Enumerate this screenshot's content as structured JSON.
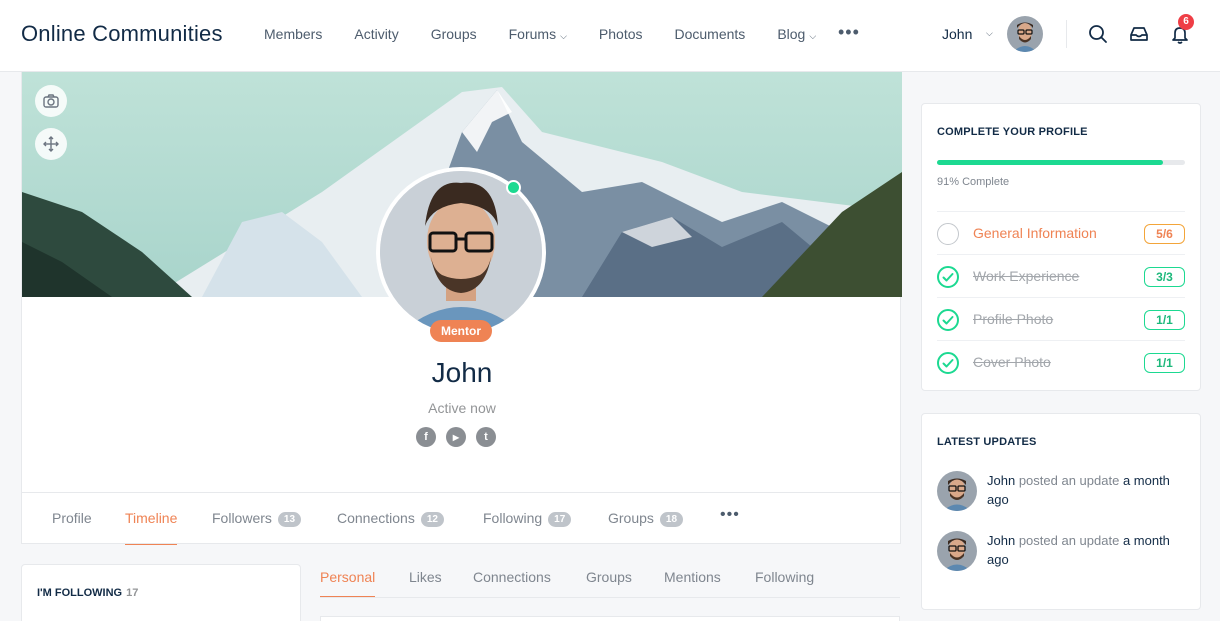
{
  "header": {
    "site_title": "Online Communities",
    "nav": [
      {
        "label": "Members",
        "active": true,
        "caret": false
      },
      {
        "label": "Activity",
        "active": false,
        "caret": false
      },
      {
        "label": "Groups",
        "active": false,
        "caret": false
      },
      {
        "label": "Forums",
        "active": false,
        "caret": true
      },
      {
        "label": "Photos",
        "active": false,
        "caret": false
      },
      {
        "label": "Documents",
        "active": false,
        "caret": false
      },
      {
        "label": "Blog",
        "active": false,
        "caret": true
      }
    ],
    "more_icon": "ellipsis-icon",
    "user_name": "John",
    "notification_count": "6",
    "icons": [
      "search-icon",
      "inbox-icon",
      "bell-icon"
    ],
    "accent_color": "#ef8354"
  },
  "profile": {
    "name": "John",
    "status": "Active now",
    "role_badge": "Mentor",
    "socials": [
      {
        "name": "facebook-icon",
        "glyph": "f"
      },
      {
        "name": "youtube-icon",
        "glyph": "▶"
      },
      {
        "name": "twitter-icon",
        "glyph": "t"
      }
    ],
    "cover_buttons": [
      "camera-icon",
      "move-icon"
    ],
    "tabs": [
      {
        "label": "Profile",
        "count": null,
        "active": false
      },
      {
        "label": "Timeline",
        "count": null,
        "active": true
      },
      {
        "label": "Followers",
        "count": "13",
        "active": false
      },
      {
        "label": "Connections",
        "count": "12",
        "active": false
      },
      {
        "label": "Following",
        "count": "17",
        "active": false
      },
      {
        "label": "Groups",
        "count": "18",
        "active": false
      }
    ]
  },
  "complete_profile": {
    "title": "COMPLETE YOUR PROFILE",
    "progress": 0.91,
    "progress_label": "91% Complete",
    "items": [
      {
        "label": "General Information",
        "count": "5/6",
        "done": false
      },
      {
        "label": "Work Experience",
        "count": "3/3",
        "done": true
      },
      {
        "label": "Profile Photo",
        "count": "1/1",
        "done": true
      },
      {
        "label": "Cover Photo",
        "count": "1/1",
        "done": true
      }
    ]
  },
  "latest_updates": {
    "title": "LATEST UPDATES",
    "items": [
      {
        "user": "John",
        "action": "posted an update",
        "tail": "a month ago"
      },
      {
        "user": "John",
        "action": "posted an update",
        "tail": "a month ago"
      }
    ]
  },
  "following_widget": {
    "title": "I'M FOLLOWING",
    "count": "17"
  },
  "activity_tabs": [
    {
      "label": "Personal",
      "active": true
    },
    {
      "label": "Likes",
      "active": false
    },
    {
      "label": "Connections",
      "active": false
    },
    {
      "label": "Groups",
      "active": false
    },
    {
      "label": "Mentions",
      "active": false
    },
    {
      "label": "Following",
      "active": false
    }
  ]
}
